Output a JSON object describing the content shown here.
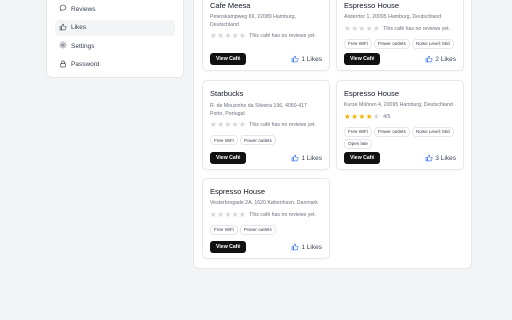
{
  "sidebar": {
    "items": [
      {
        "label": "Reviews",
        "icon": "chat-bubble-icon",
        "active": false
      },
      {
        "label": "Likes",
        "icon": "thumbs-up-icon",
        "active": true
      },
      {
        "label": "Settings",
        "icon": "gear-icon",
        "active": false
      },
      {
        "label": "Password",
        "icon": "lock-icon",
        "active": false
      }
    ]
  },
  "cafes": [
    {
      "name": "Cafe Meesa",
      "address": "Peterskampweg 69, 22089 Hamburg, Deutschland",
      "rating": 0,
      "rating_text": "This café has no reviews yet.",
      "tags": [],
      "view_label": "View Café",
      "likes_label": "1 Likes"
    },
    {
      "name": "Espresso House",
      "address": "Alsterrtor 1, 20095 Hamburg, Deutschland",
      "rating": 0,
      "rating_text": "This café has no reviews yet.",
      "tags": [
        "Free WiFi",
        "Power outlets",
        "Noise Level: Mid"
      ],
      "view_label": "View Café",
      "likes_label": "2 Likes"
    },
    {
      "name": "Starbucks",
      "address": "R. de Mouzinho da Silveira 196, 4050-417 Porto, Portugal",
      "rating": 0,
      "rating_text": "This café has no reviews yet.",
      "tags": [
        "Free WiFi",
        "Power outlets"
      ],
      "view_label": "View Café",
      "likes_label": "1 Likes"
    },
    {
      "name": "Espresso House",
      "address": "Kurze Mühren 4, 20095 Hamburg, Deutschland",
      "rating": 4,
      "rating_text": "4/5",
      "tags": [
        "Free WiFi",
        "Power outlets",
        "Noise Level: Mid",
        "Open late"
      ],
      "view_label": "View Café",
      "likes_label": "3 Likes"
    },
    {
      "name": "Espresso House",
      "address": "Vesterbrogade 2A, 1620 København, Danmark",
      "rating": 0,
      "rating_text": "This café has no reviews yet.",
      "tags": [
        "Free WiFi",
        "Power outlets"
      ],
      "view_label": "View Café",
      "likes_label": "1 Likes"
    }
  ],
  "colors": {
    "accent_button": "#111111",
    "star_on": "#f5b301",
    "star_off": "#d1d5db"
  }
}
